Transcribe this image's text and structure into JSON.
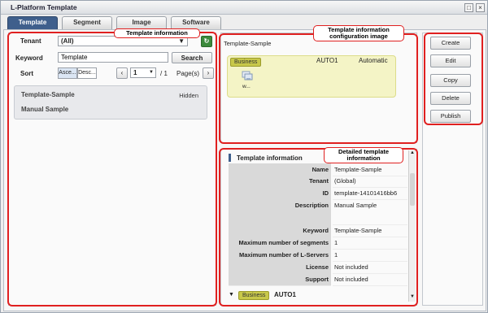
{
  "window": {
    "title": "L-Platform Template"
  },
  "tabs": [
    {
      "label": "Template",
      "active": true
    },
    {
      "label": "Segment",
      "active": false
    },
    {
      "label": "Image",
      "active": false
    },
    {
      "label": "Software",
      "active": false
    }
  ],
  "filter": {
    "tenant_label": "Tenant",
    "tenant_value": "(All)",
    "keyword_label": "Keyword",
    "keyword_value": "Template",
    "search_label": "Search",
    "sort_label": "Sort",
    "sort_asc": "Asce...",
    "sort_desc": "Desc...",
    "page_value": "1",
    "page_total": "/  1",
    "pages_label": "Page(s)"
  },
  "template_list": [
    {
      "name": "Template-Sample",
      "tag": "Hidden"
    },
    {
      "name": "Manual Sample",
      "tag": ""
    }
  ],
  "config_image": {
    "title": "Template-Sample",
    "segment_badge": "Business",
    "segment_name": "AUTO1",
    "segment_mode": "Automatic",
    "server_label": "w..."
  },
  "detail": {
    "heading": "Template information",
    "rows": [
      {
        "key": "Name",
        "value": "Template-Sample"
      },
      {
        "key": "Tenant",
        "value": "(Global)"
      },
      {
        "key": "ID",
        "value": "template-14101416bb6"
      },
      {
        "key": "Description",
        "value": "Manual Sample"
      },
      {
        "key": "Keyword",
        "value": "Template-Sample"
      },
      {
        "key": "Maximum number of segments",
        "value": "1"
      },
      {
        "key": "Maximum number of L-Servers",
        "value": "1"
      },
      {
        "key": "License",
        "value": "Not included"
      },
      {
        "key": "Support",
        "value": "Not included"
      }
    ],
    "segment_badge": "Business",
    "segment_name": "AUTO1"
  },
  "actions": {
    "create": "Create",
    "edit": "Edit",
    "copy": "Copy",
    "delete": "Delete",
    "publish": "Publish"
  },
  "callouts": {
    "template_info": "Template information",
    "config_image": "Template information configuration image",
    "detailed_info": "Detailed template information"
  },
  "colors": {
    "active_tab": "#3f5f8c",
    "badge": "#c8c84a",
    "callout_border": "#e02020"
  }
}
